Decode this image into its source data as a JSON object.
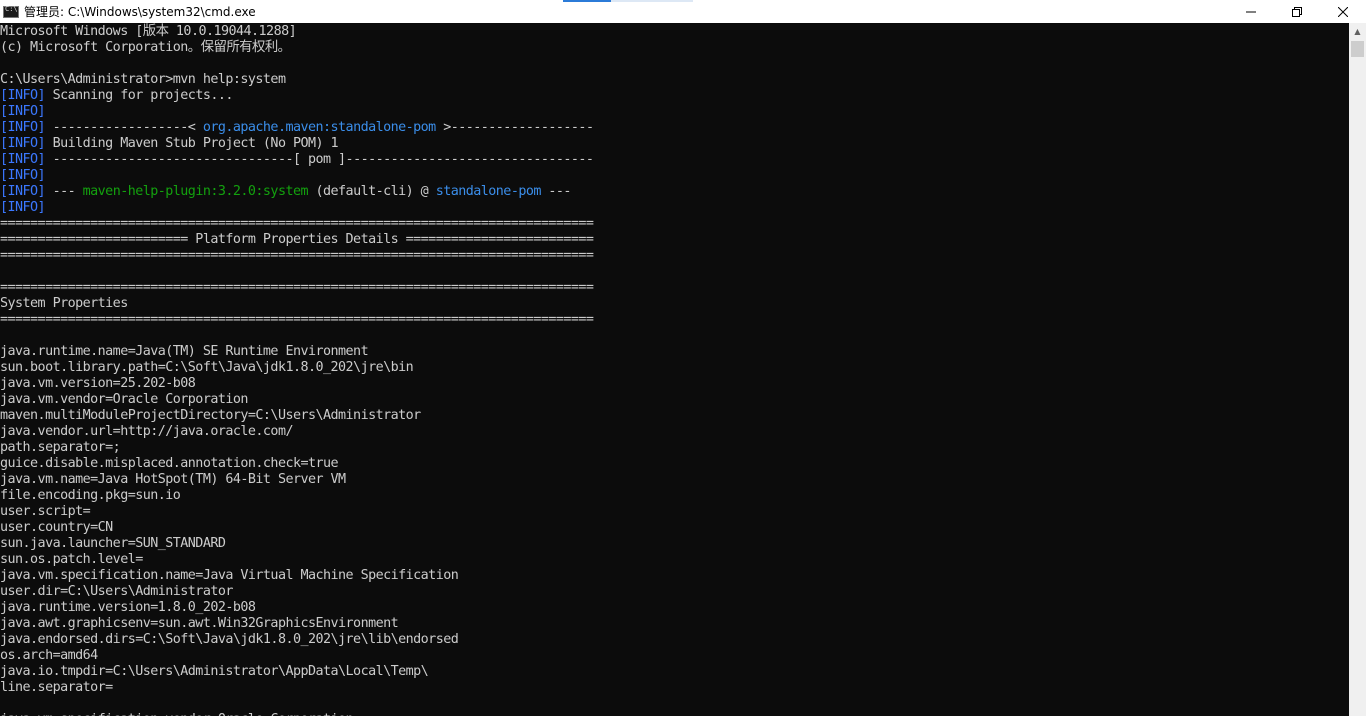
{
  "window": {
    "title": "管理员: C:\\Windows\\system32\\cmd.exe",
    "controls": {
      "minimize": "—",
      "maximize": "❐",
      "close": "✕"
    }
  },
  "console": {
    "lines": [
      [
        {
          "t": "Microsoft Windows [版本 10.0.19044.1288]"
        }
      ],
      [
        {
          "t": "(c) Microsoft Corporation。保留所有权利。"
        }
      ],
      [
        {
          "t": ""
        }
      ],
      [
        {
          "t": "C:\\Users\\Administrator>mvn help:system"
        }
      ],
      [
        {
          "t": "[INFO]",
          "c": "info"
        },
        {
          "t": " Scanning for projects..."
        }
      ],
      [
        {
          "t": "[INFO]",
          "c": "info"
        }
      ],
      [
        {
          "t": "[INFO]",
          "c": "info"
        },
        {
          "t": " ------------------< "
        },
        {
          "t": "org.apache.maven:standalone-pom",
          "c": "cyan"
        },
        {
          "t": " >-------------------"
        }
      ],
      [
        {
          "t": "[INFO]",
          "c": "info"
        },
        {
          "t": " Building Maven Stub Project (No POM) 1"
        }
      ],
      [
        {
          "t": "[INFO]",
          "c": "info"
        },
        {
          "t": " --------------------------------[ pom ]---------------------------------"
        }
      ],
      [
        {
          "t": "[INFO]",
          "c": "info"
        }
      ],
      [
        {
          "t": "[INFO]",
          "c": "info"
        },
        {
          "t": " --- "
        },
        {
          "t": "maven-help-plugin:3.2.0:system",
          "c": "green"
        },
        {
          "t": " (default-cli) @ "
        },
        {
          "t": "standalone-pom",
          "c": "cyan"
        },
        {
          "t": " ---"
        }
      ],
      [
        {
          "t": "[INFO]",
          "c": "info"
        }
      ],
      [
        {
          "t": "==============================================================================="
        }
      ],
      [
        {
          "t": "========================= Platform Properties Details ========================="
        }
      ],
      [
        {
          "t": "==============================================================================="
        }
      ],
      [
        {
          "t": ""
        }
      ],
      [
        {
          "t": "==============================================================================="
        }
      ],
      [
        {
          "t": "System Properties"
        }
      ],
      [
        {
          "t": "==============================================================================="
        }
      ],
      [
        {
          "t": ""
        }
      ],
      [
        {
          "t": "java.runtime.name=Java(TM) SE Runtime Environment"
        }
      ],
      [
        {
          "t": "sun.boot.library.path=C:\\Soft\\Java\\jdk1.8.0_202\\jre\\bin"
        }
      ],
      [
        {
          "t": "java.vm.version=25.202-b08"
        }
      ],
      [
        {
          "t": "java.vm.vendor=Oracle Corporation"
        }
      ],
      [
        {
          "t": "maven.multiModuleProjectDirectory=C:\\Users\\Administrator"
        }
      ],
      [
        {
          "t": "java.vendor.url=http://java.oracle.com/"
        }
      ],
      [
        {
          "t": "path.separator=;"
        }
      ],
      [
        {
          "t": "guice.disable.misplaced.annotation.check=true"
        }
      ],
      [
        {
          "t": "java.vm.name=Java HotSpot(TM) 64-Bit Server VM"
        }
      ],
      [
        {
          "t": "file.encoding.pkg=sun.io"
        }
      ],
      [
        {
          "t": "user.script="
        }
      ],
      [
        {
          "t": "user.country=CN"
        }
      ],
      [
        {
          "t": "sun.java.launcher=SUN_STANDARD"
        }
      ],
      [
        {
          "t": "sun.os.patch.level="
        }
      ],
      [
        {
          "t": "java.vm.specification.name=Java Virtual Machine Specification"
        }
      ],
      [
        {
          "t": "user.dir=C:\\Users\\Administrator"
        }
      ],
      [
        {
          "t": "java.runtime.version=1.8.0_202-b08"
        }
      ],
      [
        {
          "t": "java.awt.graphicsenv=sun.awt.Win32GraphicsEnvironment"
        }
      ],
      [
        {
          "t": "java.endorsed.dirs=C:\\Soft\\Java\\jdk1.8.0_202\\jre\\lib\\endorsed"
        }
      ],
      [
        {
          "t": "os.arch=amd64"
        }
      ],
      [
        {
          "t": "java.io.tmpdir=C:\\Users\\Administrator\\AppData\\Local\\Temp\\"
        }
      ],
      [
        {
          "t": "line.separator="
        }
      ],
      [
        {
          "t": ""
        }
      ],
      [
        {
          "t": "java.vm.specification.vendor=Oracle Corporation"
        }
      ]
    ]
  },
  "colors": {
    "background": "#0c0c0c",
    "text": "#cccccc",
    "info": "#3b78ff",
    "cyan": "#3b8eea",
    "green": "#13a10e"
  },
  "scrollbar": {
    "up_arrow": "▲"
  }
}
